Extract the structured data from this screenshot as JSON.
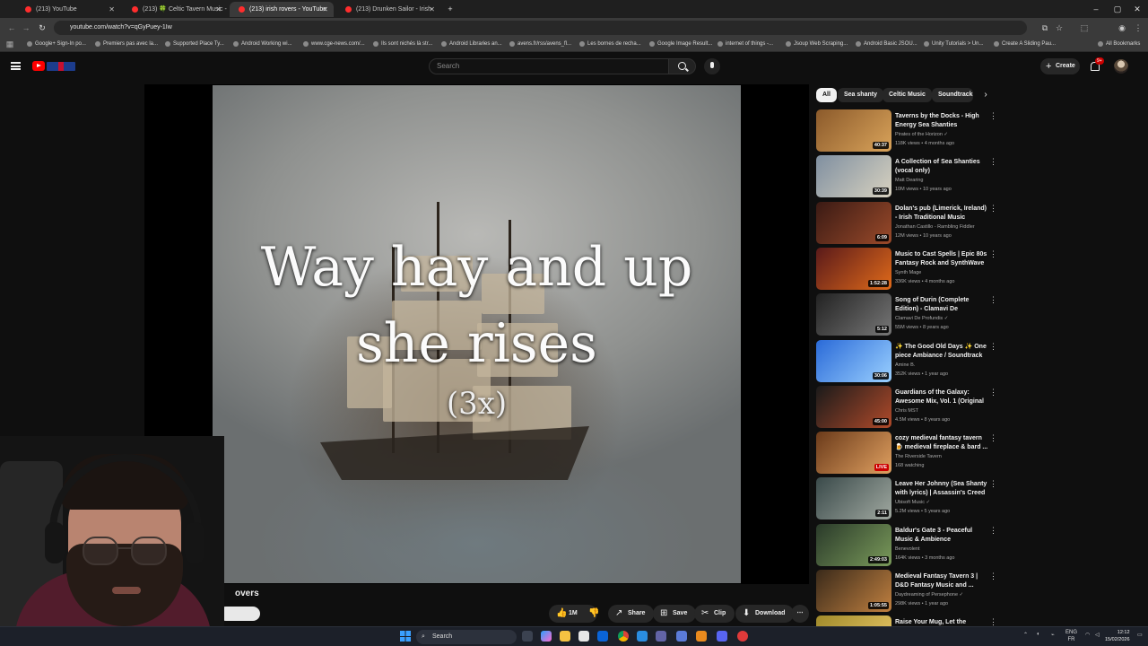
{
  "browser": {
    "tabs": [
      {
        "label": "(213) YouTube",
        "active": false
      },
      {
        "label": "(213) 🍀 Celtic Tavern Music -",
        "active": false
      },
      {
        "label": "(213) irish rovers - YouTube",
        "active": true
      },
      {
        "label": "(213) Drunken Sailor - Irish",
        "active": false
      }
    ],
    "url": "youtube.com/watch?v=qGyPuey-1Iw",
    "bookmarks": [
      "Google+ Sign-In po...",
      "Premiers pas avec la...",
      "Supported Place Ty...",
      "Android Working wi...",
      "www.cge-news.com/...",
      "Ils sont nichés là str...",
      "Android Libraries an...",
      "avens.fr/rss/avens_fl...",
      "Les bornes de recha...",
      "Google Image Result...",
      "internet of things -...",
      "Jsoup Web Scraping...",
      "Android Basic JSOU...",
      "Unity Tutorials > Un...",
      "Create A Sliding Pau..."
    ],
    "all_bookmarks": "All Bookmarks"
  },
  "youtube": {
    "search_placeholder": "Search",
    "create_label": "Create",
    "notif_badge": "9+",
    "video": {
      "lyric_line1": "Way hay and up",
      "lyric_line2": "she rises",
      "lyric_line3": "(3x)",
      "title_fragment": "overs"
    },
    "actions": {
      "like": "1M",
      "share": "Share",
      "save": "Save",
      "clip": "Clip",
      "download": "Download"
    },
    "chips": [
      "All",
      "Sea shanty",
      "Celtic Music",
      "Soundtrack"
    ],
    "recommendations": [
      {
        "title": "Taverns by the Docks - High Energy Sea Shanties",
        "channel": "Pirates of the Horizon ✓",
        "meta": "118K views • 4 months ago",
        "duration": "40:37",
        "live": false,
        "colors": [
          "#8b5a2b",
          "#d9a35a"
        ]
      },
      {
        "title": "A Collection of Sea Shanties (vocal only)",
        "channel": "Matt Dearing",
        "meta": "10M views • 10 years ago",
        "duration": "30:39",
        "live": false,
        "colors": [
          "#7f8fa0",
          "#d8d2c0"
        ]
      },
      {
        "title": "Dolan's pub (Limerick, Ireland) - Irish Traditional Music Session",
        "channel": "Jonathan Castillo - Rambling Fiddler",
        "meta": "12M views • 10 years ago",
        "duration": "6:09",
        "live": false,
        "colors": [
          "#3a1a14",
          "#9a4a2a"
        ]
      },
      {
        "title": "Music to Cast Spells | Epic 80s Fantasy Rock and SynthWave ...",
        "channel": "Synth Mage",
        "meta": "336K views • 4 months ago",
        "duration": "1:52:28",
        "live": false,
        "colors": [
          "#5a1a1a",
          "#e06a1a"
        ]
      },
      {
        "title": "Song of Durin (Complete Edition) - Clamavi De Profundis",
        "channel": "Clamavi De Profundis ✓",
        "meta": "55M views • 8 years ago",
        "duration": "5:12",
        "live": false,
        "colors": [
          "#222",
          "#777"
        ]
      },
      {
        "title": "✨ The Good Old Days ✨ One piece Ambiance / Soundtrack",
        "channel": "Amine B.",
        "meta": "352K views • 1 year ago",
        "duration": "30:06",
        "live": false,
        "colors": [
          "#2a6ad8",
          "#9ad0ff"
        ]
      },
      {
        "title": "Guardians of the Galaxy: Awesome Mix, Vol. 1 (Original ...",
        "channel": "Chris MST",
        "meta": "4.5M views • 8 years ago",
        "duration": "45:00",
        "live": false,
        "colors": [
          "#1a1a1a",
          "#b04a2a"
        ]
      },
      {
        "title": "cozy medieval fantasy tavern 🍺 medieval fireplace & bard ...",
        "channel": "The Riverside Tavern",
        "meta": "168 watching",
        "duration": "LIVE",
        "live": true,
        "colors": [
          "#6a3a1a",
          "#e0a060"
        ]
      },
      {
        "title": "Leave Her Johnny (Sea Shanty with lyrics) | Assassin's Creed ...",
        "channel": "Ubisoft Music ✓",
        "meta": "5.2M views • 5 years ago",
        "duration": "2:11",
        "live": false,
        "colors": [
          "#3a4a4a",
          "#a0a8a0"
        ]
      },
      {
        "title": "Baldur's Gate 3 - Peaceful Music & Ambience",
        "channel": "Benevolent",
        "meta": "164K views • 3 months ago",
        "duration": "2:49:03",
        "live": false,
        "colors": [
          "#2a3a2a",
          "#7a9a5a"
        ]
      },
      {
        "title": "Medieval Fantasy Tavern 3 | D&D Fantasy Music and ...",
        "channel": "Daydreaming of Persephone ✓",
        "meta": "298K views • 1 year ago",
        "duration": "1:05:55",
        "live": false,
        "colors": [
          "#3a2a1a",
          "#c08040"
        ]
      },
      {
        "title": "Raise Your Mug, Let the Strings",
        "channel": "",
        "meta": "",
        "duration": "",
        "live": false,
        "colors": [
          "#a08a2a",
          "#e0c060"
        ]
      }
    ]
  },
  "taskbar": {
    "search": "Search",
    "lang_line1": "ENG",
    "lang_line2": "FR",
    "time": "12:12",
    "date": "15/02/2026"
  }
}
